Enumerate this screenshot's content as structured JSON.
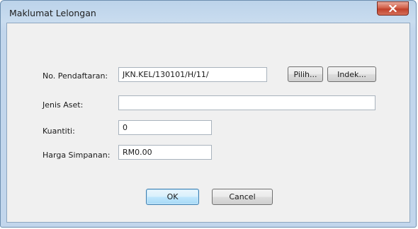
{
  "window": {
    "title": "Maklumat Lelongan"
  },
  "form": {
    "no_pendaftaran": {
      "label": "No. Pendaftaran:",
      "value": "JKN.KEL/130101/H/11/"
    },
    "jenis_aset": {
      "label": "Jenis Aset:",
      "value": ""
    },
    "kuantiti": {
      "label": "Kuantiti:",
      "value": "0"
    },
    "harga_simpanan": {
      "label": "Harga Simpanan:",
      "value": "RM0.00"
    }
  },
  "buttons": {
    "pilih": "Pilih...",
    "indek": "Indek...",
    "ok": "OK",
    "cancel": "Cancel"
  },
  "icons": {
    "close": "close-icon"
  }
}
